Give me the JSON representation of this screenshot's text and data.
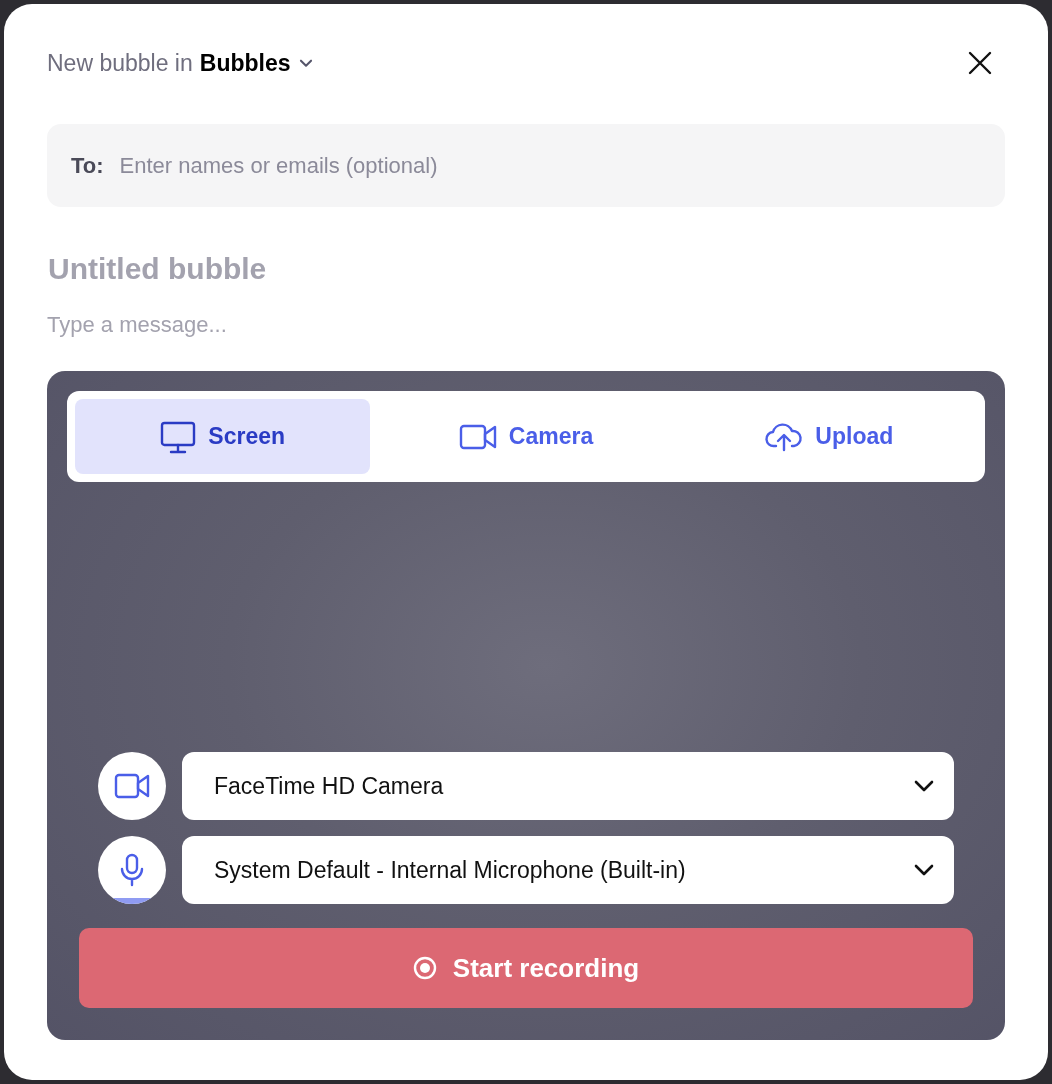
{
  "header": {
    "prefix": "New bubble in",
    "folder": "Bubbles"
  },
  "to": {
    "label": "To:",
    "placeholder": "Enter names or emails (optional)"
  },
  "title": {
    "placeholder": "Untitled bubble"
  },
  "message": {
    "placeholder": "Type a message..."
  },
  "tabs": [
    {
      "label": "Screen",
      "kind": "screen",
      "selected": true
    },
    {
      "label": "Camera",
      "kind": "camera",
      "selected": false
    },
    {
      "label": "Upload",
      "kind": "upload",
      "selected": false
    }
  ],
  "devices": [
    {
      "kind": "camera",
      "value": "FaceTime HD Camera"
    },
    {
      "kind": "microphone",
      "value": "System Default - Internal Microphone (Built-in)"
    }
  ],
  "record_button": "Start recording"
}
